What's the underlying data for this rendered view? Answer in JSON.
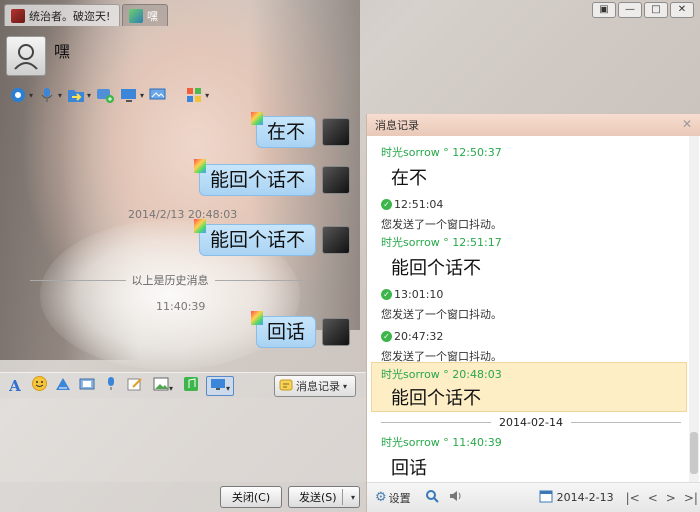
{
  "tabs": [
    {
      "label": "统治者。破迩天!"
    },
    {
      "label": "嘿"
    }
  ],
  "window_buttons": [
    "▣",
    "—",
    "□",
    "✕"
  ],
  "header": {
    "nickname": "嘿"
  },
  "chat": {
    "messages": [
      {
        "text": "在不"
      },
      {
        "text": "能回个话不"
      },
      {
        "text": "能回个话不"
      },
      {
        "text": "回话"
      }
    ],
    "timestamp1": "2014/2/13 20:48:03",
    "history_divider": "以上是历史消息",
    "timestamp2": "11:40:39"
  },
  "input_toolbar": {
    "history_button": "消息记录"
  },
  "input": {
    "text": ".."
  },
  "buttons": {
    "close": "关闭(C)",
    "send": "发送(S)"
  },
  "history_panel": {
    "title": "消息记录",
    "entries": [
      {
        "header": "时光sorrow ° 12:50:37",
        "text": "在不"
      },
      {
        "time": "12:51:04",
        "note": "您发送了一个窗口抖动。"
      },
      {
        "header": "时光sorrow ° 12:51:17",
        "text": "能回个话不"
      },
      {
        "time": "13:01:10",
        "note": "您发送了一个窗口抖动。"
      },
      {
        "time": "20:47:32",
        "note": "您发送了一个窗口抖动。"
      },
      {
        "header": "时光sorrow ° 20:48:03",
        "text": "能回个话不"
      },
      {
        "header": "时光sorrow ° 11:40:39",
        "text": "回话"
      }
    ],
    "date_divider": "2014-02-14",
    "settings_label": "设置",
    "date": "2014-2-13"
  },
  "colors": {
    "accent_green": "#27a84a",
    "bubble": "#b8dcf7",
    "highlight": "#fdeec6"
  }
}
